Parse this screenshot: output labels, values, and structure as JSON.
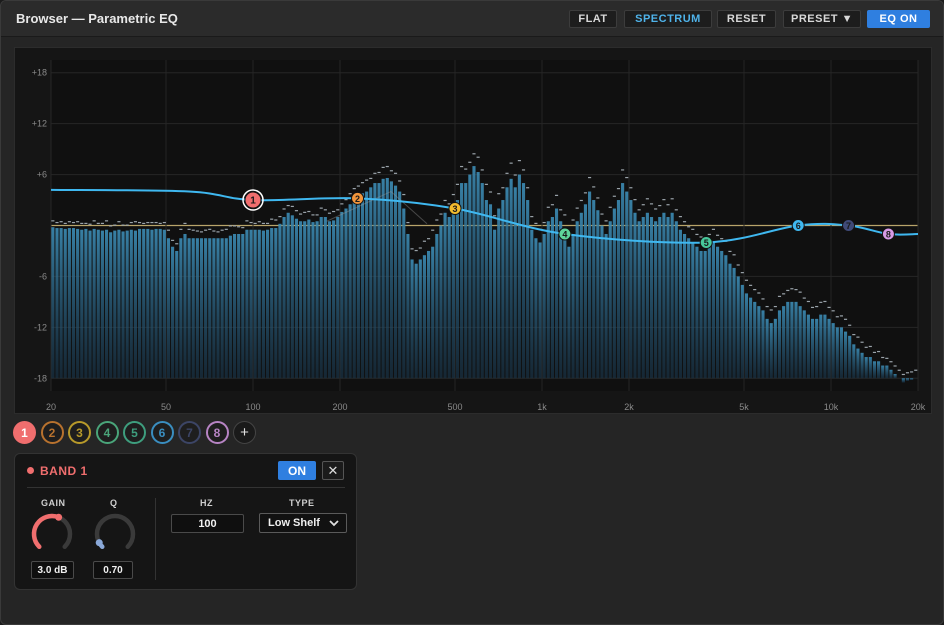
{
  "window": {
    "title": "Browser — Parametric EQ"
  },
  "toolbar": {
    "flat": "FLAT",
    "spectrum": "SPECTRUM",
    "reset": "RESET",
    "preset": "PRESET ▼",
    "eq_on": "EQ ON"
  },
  "graph": {
    "y_ticks": [
      "+18",
      "+12",
      "+6",
      "0",
      "-6",
      "-12",
      "-18"
    ],
    "y_tick_values": [
      18,
      12,
      6,
      0,
      -6,
      -12,
      -18
    ],
    "x_ticks": [
      "20",
      "50",
      "100",
      "200",
      "500",
      "1k",
      "2k",
      "5k",
      "10k",
      "20k"
    ],
    "x_tick_hz": [
      20,
      50,
      100,
      200,
      500,
      1000,
      2000,
      5000,
      10000,
      20000
    ],
    "freq_range_hz": [
      20,
      20000
    ],
    "db_range": [
      -19.5,
      19.5
    ],
    "curve_color": "#3fb8f0",
    "zero_line_color": "#b8a46a",
    "bar_color": "#3a7fa6",
    "nodes": [
      {
        "label": "1",
        "hz": 100,
        "db": 3.0,
        "color": "#f06e6e",
        "selected": true
      },
      {
        "label": "2",
        "hz": 230,
        "db": 3.2,
        "color": "#f2963c"
      },
      {
        "label": "3",
        "hz": 500,
        "db": 2.0,
        "color": "#f2bc2e"
      },
      {
        "label": "4",
        "hz": 1200,
        "db": -1.0,
        "color": "#5ed49a"
      },
      {
        "label": "5",
        "hz": 3700,
        "db": -2.0,
        "color": "#47c79a"
      },
      {
        "label": "6",
        "hz": 7700,
        "db": 0.0,
        "color": "#3fb8f0"
      },
      {
        "label": "7",
        "hz": 11500,
        "db": 0.0,
        "color": "#3f4a78"
      },
      {
        "label": "8",
        "hz": 15800,
        "db": -1.0,
        "color": "#d79ae6"
      }
    ],
    "spectrum_db": [
      -0.2,
      -0.3,
      -0.3,
      -0.4,
      -0.3,
      -0.3,
      -0.4,
      -0.5,
      -0.4,
      -0.6,
      -0.4,
      -0.5,
      -0.6,
      -0.5,
      -0.8,
      -0.6,
      -0.5,
      -0.7,
      -0.6,
      -0.5,
      -0.6,
      -0.4,
      -0.4,
      -0.4,
      -0.5,
      -0.4,
      -0.4,
      -0.5,
      -1.5,
      -2.5,
      -3.0,
      -1.5,
      -1.0,
      -1.5,
      -1.5,
      -1.5,
      -1.5,
      -1.5,
      -1.5,
      -1.5,
      -1.5,
      -1.5,
      -1.5,
      -1.2,
      -1.0,
      -1.0,
      -1.0,
      -0.5,
      -0.5,
      -0.5,
      -0.5,
      -0.6,
      -0.5,
      -0.3,
      -0.3,
      0.2,
      1.0,
      1.5,
      1.2,
      0.8,
      0.5,
      0.5,
      0.7,
      0.4,
      0.5,
      1.0,
      1.0,
      0.5,
      0.6,
      1.0,
      1.6,
      2.0,
      2.5,
      3.0,
      3.5,
      3.8,
      4.0,
      4.5,
      5.0,
      5.0,
      5.5,
      5.6,
      5.2,
      4.7,
      4.0,
      2.0,
      -1.0,
      -4.0,
      -4.5,
      -4.0,
      -3.5,
      -3.0,
      -2.5,
      -1.0,
      0.0,
      1.5,
      1.0,
      2.0,
      3.0,
      5.0,
      5.0,
      6.0,
      7.0,
      6.3,
      5.0,
      3.0,
      2.5,
      -0.5,
      2.0,
      3.0,
      4.5,
      5.5,
      4.5,
      6.0,
      5.0,
      3.0,
      -0.5,
      -1.5,
      -2.0,
      -1.0,
      0.5,
      1.0,
      2.0,
      0.5,
      -0.5,
      -2.5,
      -1.0,
      0.5,
      1.5,
      2.5,
      4.0,
      3.0,
      1.8,
      0.0,
      -1.0,
      0.5,
      2.0,
      3.0,
      5.0,
      4.0,
      3.0,
      1.5,
      0.5,
      1.0,
      1.5,
      1.0,
      0.5,
      1.0,
      1.5,
      1.0,
      1.5,
      0.5,
      -0.5,
      -1.0,
      -1.5,
      -2.0,
      -2.5,
      -3.0,
      -3.0,
      -2.5,
      -2.0,
      -2.5,
      -3.0,
      -3.5,
      -4.5,
      -5.0,
      -6.0,
      -7.0,
      -8.0,
      -8.5,
      -9.0,
      -9.5,
      -10.0,
      -11.0,
      -11.5,
      -11.0,
      -10.0,
      -9.5,
      -9.0,
      -9.0,
      -9.0,
      -9.5,
      -10.0,
      -10.5,
      -11.0,
      -11.0,
      -10.5,
      -10.5,
      -11.0,
      -11.5,
      -12.0,
      -12.0,
      -12.5,
      -13.0,
      -14.0,
      -14.5,
      -15.0,
      -15.5,
      -15.5,
      -16.0,
      -16.0,
      -16.5,
      -16.5,
      -17.0,
      -17.5,
      -18.0,
      -18.5,
      -18.3,
      -18.2,
      -18.0
    ],
    "peak_offset_db": [
      0.3,
      0.2,
      0.3,
      0.2,
      0.3,
      0.2,
      0.4,
      0.3,
      0.2,
      0.3,
      0.5,
      0.3,
      0.4,
      0.6,
      0.3,
      0.2,
      0.5,
      0.3,
      0.2,
      0.4,
      0.6,
      0.3,
      0.2,
      0.3,
      0.4,
      0.3,
      0.2,
      0.4,
      0.5,
      0.3,
      0.4,
      0.6,
      0.8,
      0.6,
      0.5,
      0.4,
      0.3,
      0.5,
      0.6,
      0.4,
      0.3,
      0.5,
      0.6,
      0.7,
      0.5,
      0.4,
      0.3,
      0.6,
      0.4,
      0.3,
      0.5,
      0.4,
      0.3,
      0.6,
      0.5,
      0.4,
      0.5,
      0.4,
      0.6,
      0.5,
      0.4,
      0.6,
      0.5,
      0.4,
      0.3,
      0.6,
      0.4,
      0.5,
      0.6,
      0.4,
      0.5,
      0.6,
      0.8,
      0.9,
      0.7,
      0.8,
      0.9,
      0.6,
      0.7,
      0.8,
      0.9,
      0.9,
      0.8,
      1.0,
      0.8,
      1.2,
      0.9,
      0.8,
      1.1,
      0.9,
      1.2,
      1.0,
      1.5,
      1.2,
      0.9,
      1.0,
      1.1,
      1.2,
      1.4,
      1.5,
      1.2,
      1.0,
      1.0,
      1.3,
      1.1,
      1.4,
      1.0,
      1.2,
      1.3,
      1.0,
      1.2,
      1.4,
      1.0,
      1.2,
      1.1,
      1.0,
      1.1,
      1.3,
      1.1,
      0.9,
      1.2,
      1.0,
      1.1,
      0.9,
      1.3,
      1.0,
      1.2,
      1.1,
      1.0,
      0.9,
      1.2,
      1.1,
      1.0,
      0.9,
      1.1,
      1.2,
      1.0,
      0.9,
      1.1,
      1.2,
      1.0,
      1.1,
      0.9,
      1.0,
      1.2,
      1.1,
      1.0,
      0.9,
      1.1,
      1.0,
      1.2,
      0.9,
      1.1,
      1.0,
      0.9,
      1.1,
      1.0,
      1.2,
      0.9,
      1.0,
      1.1,
      0.9,
      1.0,
      1.2,
      1.0,
      1.1,
      0.9,
      1.0,
      1.1,
      1.0,
      1.0,
      1.1,
      0.9,
      1.0,
      1.1,
      1.0,
      1.2,
      1.0,
      0.9,
      1.1,
      1.0,
      1.2,
      1.0,
      1.1,
      0.9,
      1.0,
      1.0,
      1.1,
      0.9,
      1.0,
      0.8,
      0.9,
      1.0,
      0.8,
      0.7,
      0.9,
      0.8,
      0.7,
      0.8,
      0.6,
      0.7,
      0.5,
      0.4
    ]
  },
  "band_selector": {
    "bands": [
      {
        "label": "1",
        "color": "#f06e6e",
        "active": true
      },
      {
        "label": "2",
        "color": "#b8722e"
      },
      {
        "label": "3",
        "color": "#b89a2a"
      },
      {
        "label": "4",
        "color": "#4aa57a"
      },
      {
        "label": "5",
        "color": "#3e9e7e"
      },
      {
        "label": "6",
        "color": "#3a8ec0"
      },
      {
        "label": "7",
        "color": "#3c4566"
      },
      {
        "label": "8",
        "color": "#b784c4"
      }
    ],
    "add": "+"
  },
  "band_panel": {
    "title": "BAND 1",
    "accent": "#f06e6e",
    "on_label": "ON",
    "close_label": "✕",
    "gain": {
      "label": "GAIN",
      "value": "3.0 dB",
      "fraction": 0.58
    },
    "q": {
      "label": "Q",
      "value": "0.70",
      "fraction": 0.06
    },
    "hz": {
      "label": "HZ",
      "value": "100"
    },
    "type": {
      "label": "TYPE",
      "value": "Low Shelf"
    }
  }
}
